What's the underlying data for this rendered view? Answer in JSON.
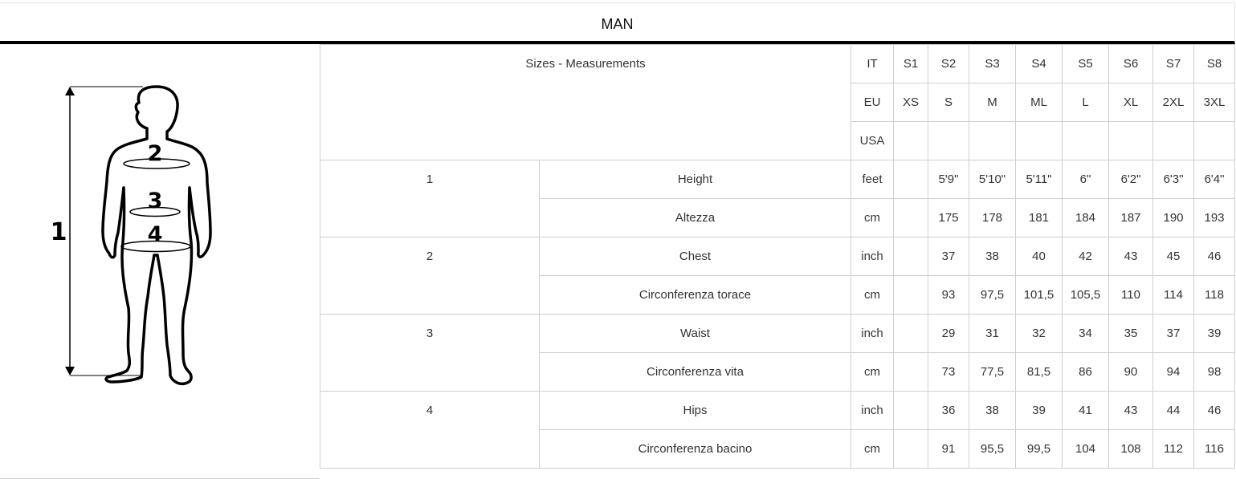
{
  "title": "MAN",
  "header": {
    "label": "Sizes - Measurements",
    "rows": [
      {
        "system": "IT",
        "values": [
          "S1",
          "S2",
          "S3",
          "S4",
          "S5",
          "S6",
          "S7",
          "S8"
        ]
      },
      {
        "system": "EU",
        "values": [
          "XS",
          "S",
          "M",
          "ML",
          "L",
          "XL",
          "2XL",
          "3XL"
        ]
      },
      {
        "system": "USA",
        "values": [
          "",
          "",
          "",
          "",
          "",
          "",
          "",
          ""
        ]
      }
    ]
  },
  "figure": {
    "height_label": "1",
    "marks": [
      "2",
      "3",
      "4"
    ]
  },
  "measurements": [
    {
      "number": "1",
      "rows": [
        {
          "name": "Height",
          "unit": "feet",
          "values": [
            "",
            "5'9\"",
            "5'10\"",
            "5'11\"",
            "6\"",
            "6'2\"",
            "6'3\"",
            "6'4\""
          ]
        },
        {
          "name": "Altezza",
          "unit": "cm",
          "values": [
            "",
            "175",
            "178",
            "181",
            "184",
            "187",
            "190",
            "193"
          ]
        }
      ]
    },
    {
      "number": "2",
      "rows": [
        {
          "name": "Chest",
          "unit": "inch",
          "values": [
            "",
            "37",
            "38",
            "40",
            "42",
            "43",
            "45",
            "46"
          ]
        },
        {
          "name": "Circonferenza torace",
          "unit": "cm",
          "values": [
            "",
            "93",
            "97,5",
            "101,5",
            "105,5",
            "110",
            "114",
            "118"
          ]
        }
      ]
    },
    {
      "number": "3",
      "rows": [
        {
          "name": "Waist",
          "unit": "inch",
          "values": [
            "",
            "29",
            "31",
            "32",
            "34",
            "35",
            "37",
            "39"
          ]
        },
        {
          "name": "Circonferenza vita",
          "unit": "cm",
          "values": [
            "",
            "73",
            "77,5",
            "81,5",
            "86",
            "90",
            "94",
            "98"
          ]
        }
      ]
    },
    {
      "number": "4",
      "rows": [
        {
          "name": "Hips",
          "unit": "inch",
          "values": [
            "",
            "36",
            "38",
            "39",
            "41",
            "43",
            "44",
            "46"
          ]
        },
        {
          "name": "Circonferenza bacino",
          "unit": "cm",
          "values": [
            "",
            "91",
            "95,5",
            "99,5",
            "104",
            "108",
            "112",
            "116"
          ]
        }
      ]
    }
  ]
}
